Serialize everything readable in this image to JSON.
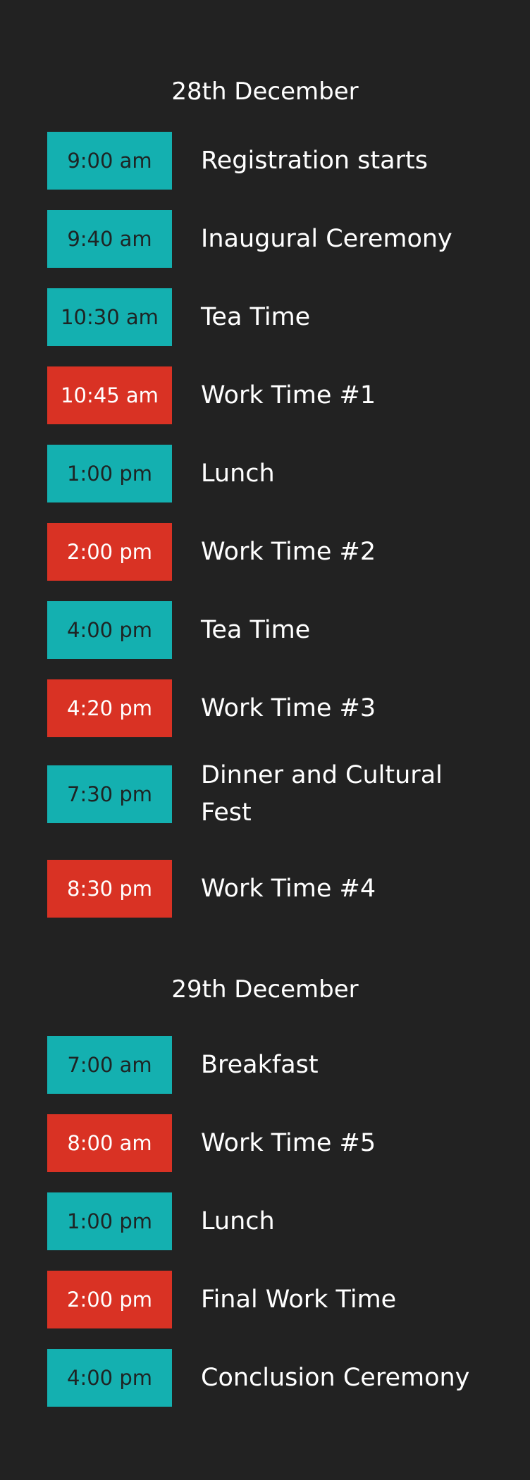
{
  "days": [
    {
      "heading": "28th December",
      "events": [
        {
          "time": "9:00 am",
          "title": "Registration starts",
          "type": "teal"
        },
        {
          "time": "9:40 am",
          "title": "Inaugural Ceremony",
          "type": "teal"
        },
        {
          "time": "10:30 am",
          "title": "Tea Time",
          "type": "teal"
        },
        {
          "time": "10:45 am",
          "title": "Work Time #1",
          "type": "red"
        },
        {
          "time": "1:00 pm",
          "title": "Lunch",
          "type": "teal"
        },
        {
          "time": "2:00 pm",
          "title": "Work Time #2",
          "type": "red"
        },
        {
          "time": "4:00 pm",
          "title": "Tea Time",
          "type": "teal"
        },
        {
          "time": "4:20 pm",
          "title": "Work Time #3",
          "type": "red"
        },
        {
          "time": "7:30 pm",
          "title": "Dinner and Cultural Fest",
          "type": "teal"
        },
        {
          "time": "8:30 pm",
          "title": "Work Time #4",
          "type": "red"
        }
      ]
    },
    {
      "heading": "29th December",
      "events": [
        {
          "time": "7:00 am",
          "title": "Breakfast",
          "type": "teal"
        },
        {
          "time": "8:00 am",
          "title": "Work Time #5",
          "type": "red"
        },
        {
          "time": "1:00 pm",
          "title": "Lunch",
          "type": "teal"
        },
        {
          "time": "2:00 pm",
          "title": "Final Work Time",
          "type": "red"
        },
        {
          "time": "4:00 pm",
          "title": "Conclusion Ceremony",
          "type": "teal"
        }
      ]
    }
  ],
  "colors": {
    "background": "#222222",
    "teal": "#14b0b0",
    "red": "#d93224",
    "text": "#ffffff"
  }
}
